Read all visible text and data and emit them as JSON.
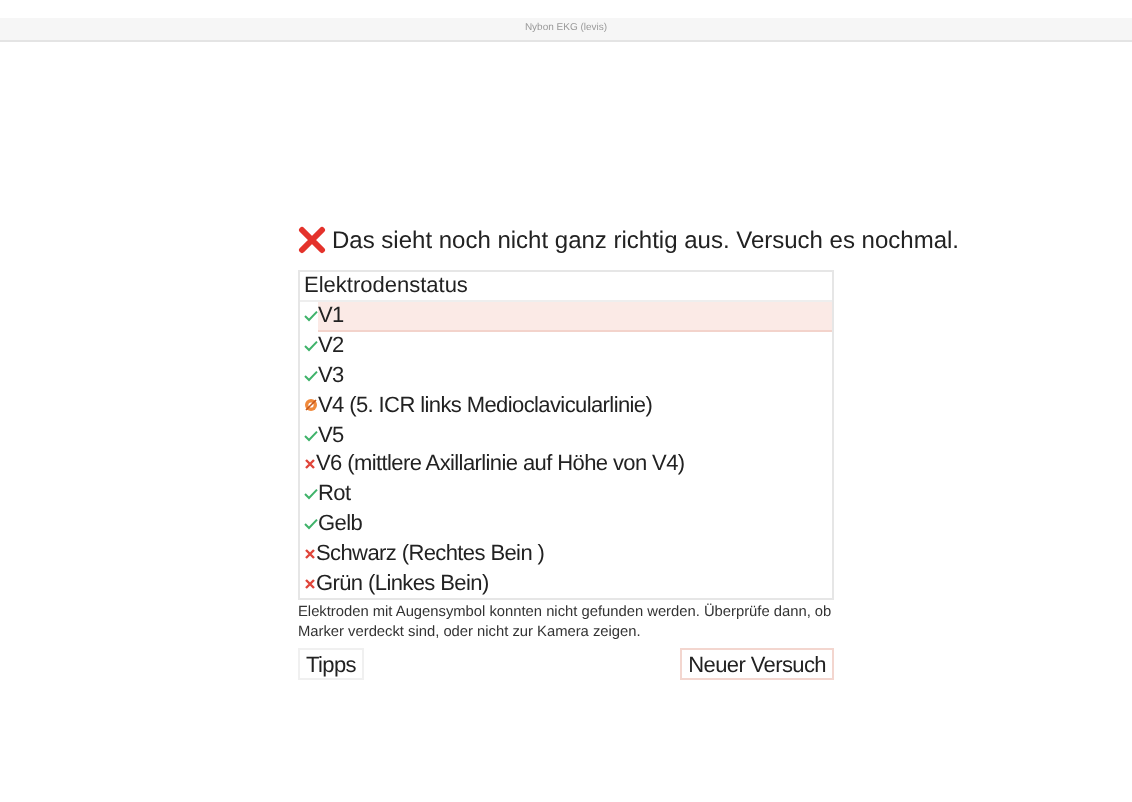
{
  "window": {
    "title": "Nybon EKG (levis)"
  },
  "message": {
    "kind": "error",
    "text": "Das sieht noch nicht ganz richtig aus. Versuch es nochmal."
  },
  "electrode_list": {
    "header": "Elektrodenstatus",
    "items": [
      {
        "label": "V1",
        "kind": "ok",
        "selected": true
      },
      {
        "label": "V2",
        "kind": "ok",
        "selected": false
      },
      {
        "label": "V3",
        "kind": "ok",
        "selected": false
      },
      {
        "label": "V4 (5. ICR links Medioclavicularlinie)",
        "kind": "hidden",
        "selected": false
      },
      {
        "label": "V5",
        "kind": "ok",
        "selected": false
      },
      {
        "label": "V6 (mittlere Axillarlinie auf Höhe von V4)",
        "kind": "wrong",
        "selected": false
      },
      {
        "label": "Rot",
        "kind": "ok",
        "selected": false
      },
      {
        "label": "Gelb",
        "kind": "ok",
        "selected": false
      },
      {
        "label": "Schwarz (Rechtes Bein )",
        "kind": "wrong",
        "selected": false
      },
      {
        "label": "Grün (Linkes Bein)",
        "kind": "wrong",
        "selected": false
      }
    ]
  },
  "hint": "Elektroden mit Augensymbol konnten nicht gefunden werden. Überprüfe dann, ob Marker verdeckt sind, oder nicht zur Kamera zeigen.",
  "buttons": [
    {
      "label": "Tipps",
      "kind": "plain"
    },
    {
      "label": "Neuer Versuch",
      "kind": "outlined"
    }
  ]
}
